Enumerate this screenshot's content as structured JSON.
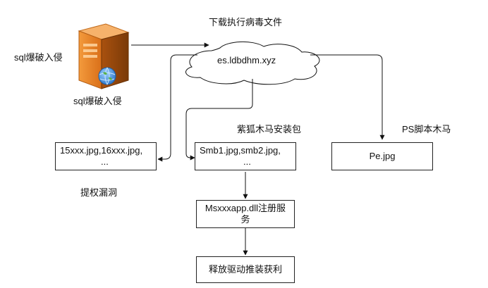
{
  "top_label": "下载执行病毒文件",
  "cloud_host": "es.ldbdhm.xyz",
  "server": {
    "side_label": "sql爆破入侵",
    "bottom_label": "sql爆破入侵",
    "icon": "server-globe-icon"
  },
  "boxes": {
    "left": {
      "line1": "15xxx.jpg,16xxx.jpg,",
      "line2": "..."
    },
    "middle": {
      "line1": "Smb1.jpg,smb2.jpg,",
      "line2": "..."
    },
    "right": {
      "text": "Pe.jpg"
    },
    "dll": {
      "text": "Msxxxapp.dll注册服务"
    },
    "driver": {
      "text": "释放驱动推装获利"
    }
  },
  "labels": {
    "middle_caption": "紫狐木马安装包",
    "right_caption": "PS脚本木马",
    "left_caption": "提权漏洞"
  },
  "colors": {
    "line": "#111111",
    "server_orange": "#e8872d",
    "server_dark": "#b85a12",
    "globe": "#3f8fd8"
  }
}
